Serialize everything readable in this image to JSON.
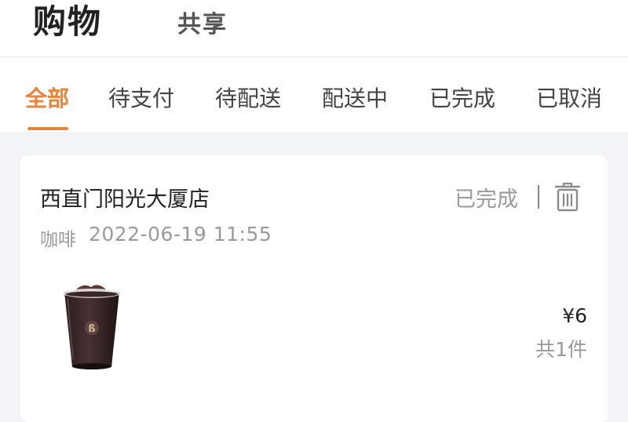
{
  "header": {
    "tabs": [
      {
        "label": "购物"
      },
      {
        "label": "共享"
      }
    ]
  },
  "status_tabs": [
    {
      "label": "全部"
    },
    {
      "label": "待支付"
    },
    {
      "label": "待配送"
    },
    {
      "label": "配送中"
    },
    {
      "label": "已完成"
    },
    {
      "label": "已取消"
    }
  ],
  "order": {
    "store": "西直门阳光大厦店",
    "status": "已完成",
    "category": "咖啡",
    "time": "2022-06-19 11:55",
    "price": "¥6",
    "count": "共1件",
    "icons": {
      "delete": "trash-icon",
      "product": "iced-coffee-cup"
    }
  },
  "colors": {
    "accent": "#e8833a",
    "background": "#f3f4f8",
    "muted_text": "#9a9a9a"
  }
}
